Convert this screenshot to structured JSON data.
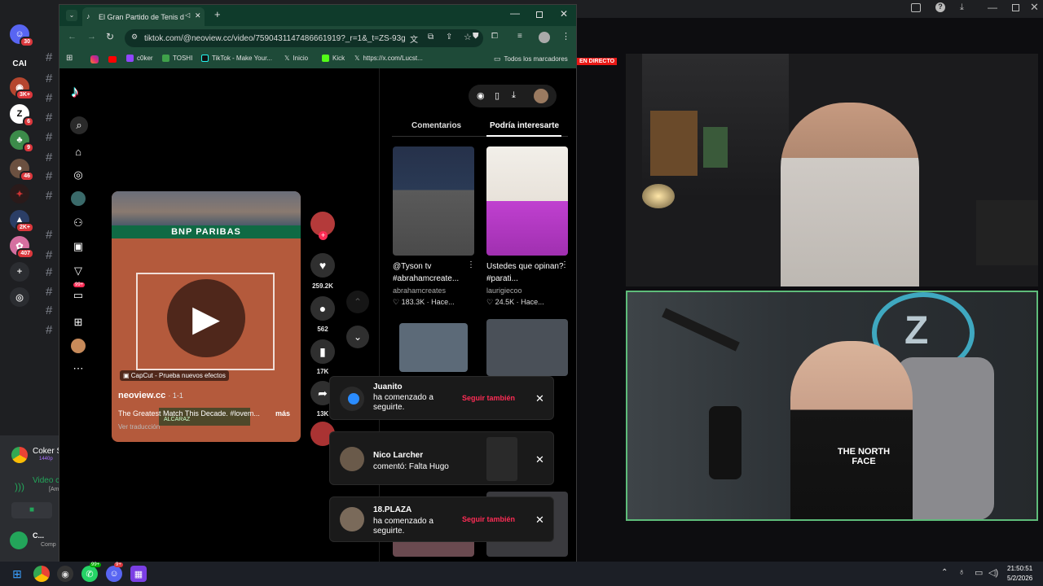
{
  "discord": {
    "badges": [
      "30",
      "3K+",
      "6",
      "9",
      "46",
      "2K+",
      "407",
      "99+"
    ],
    "server_label": "CAI",
    "panel": {
      "stream_title": "Coker S",
      "stream_quality": "1440p",
      "voice_label": "Video c",
      "voice_sub": "[Am",
      "user_name": "C...",
      "user_status": "Comp"
    }
  },
  "browser": {
    "tab_title": "El Gran Partido de Tenis de",
    "url": "tiktok.com/@neoview.cc/video/7590431147486661919?_r=1&_t=ZS-93gKL...",
    "bookmarks": [
      "c0ker",
      "TOSHI",
      "TikTok - Make Your...",
      "Inicio",
      "Kick",
      "https://x.com/Lucst..."
    ],
    "bookmarks_folder": "Todos los marcadores"
  },
  "tiktok": {
    "tabs": [
      "Comentarios",
      "Podría interesarte"
    ],
    "video": {
      "banner_text": "BNP PARIBAS",
      "capcut_label": "CapCut - Prueba nuevos efectos",
      "author": "neoview.cc",
      "date": "· 1-1",
      "caption": "The Greatest Match This Decade. #lovem...",
      "more": "más",
      "translate": "Ver traducción",
      "score_text": "ALCARAZ"
    },
    "actions": {
      "likes": "259.2K",
      "comments": "562",
      "saves": "17K",
      "shares": "13K"
    },
    "recommendations": [
      {
        "title": "@Tyson tv #abrahamcreate...",
        "user": "abrahamcreates",
        "stat": "183.3K · Hace..."
      },
      {
        "title": "Ustedes que opinan? #parati...",
        "user": "laurigiecoo",
        "stat": "24.5K · Hace..."
      }
    ],
    "notifications": [
      {
        "name": "Juanito",
        "text": "ha comenzado a seguirte.",
        "action": "Seguir también"
      },
      {
        "name": "Nico Larcher",
        "text": "comentó: Falta Hugo",
        "action": ""
      },
      {
        "name": "18.PLAZA",
        "text": "ha comenzado a seguirte.",
        "action": "Seguir también"
      }
    ]
  },
  "stream": {
    "live_tag": "EN DIRECTO",
    "shirt_text": "THE NORTH FACE"
  },
  "taskbar": {
    "time": "21:50:51",
    "date": "5/2/2026",
    "badges": [
      "99+",
      "9+"
    ]
  }
}
